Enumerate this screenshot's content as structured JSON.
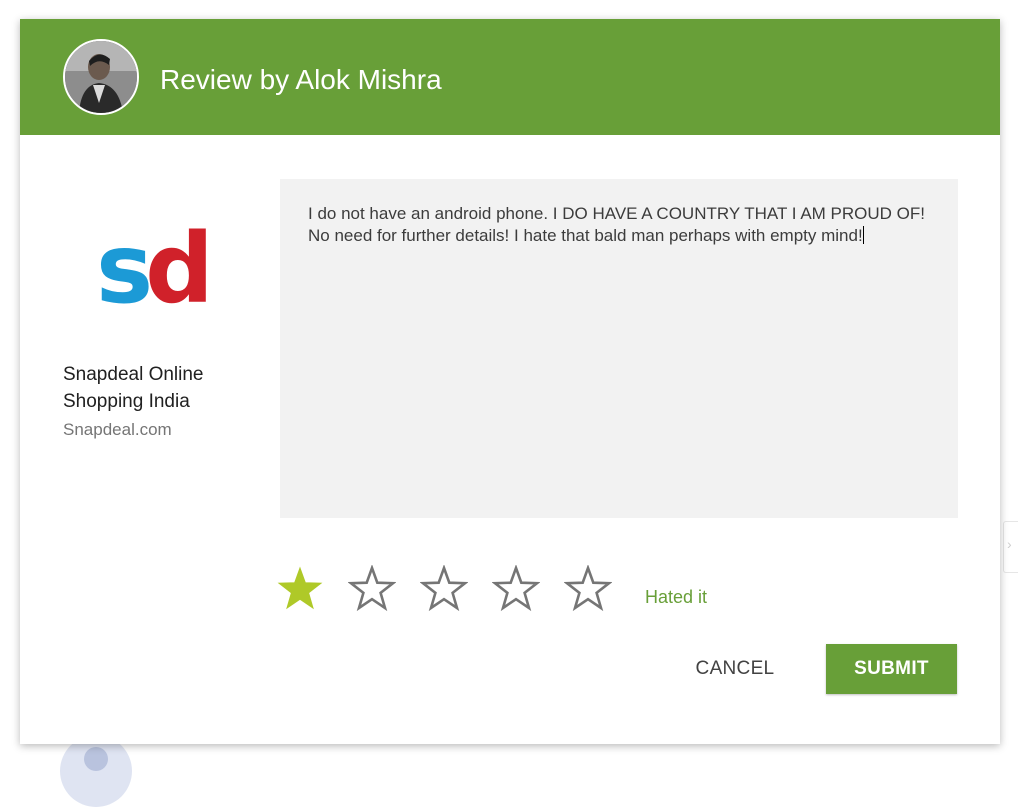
{
  "dialog": {
    "title": "Review by Alok Mishra",
    "header_color": "#689f38"
  },
  "app": {
    "logo_icon": "snapdeal-logo-icon",
    "logo_text": "sd",
    "name": "Snapdeal Online Shopping India",
    "publisher": "Snapdeal.com"
  },
  "review": {
    "text": "I do not have an android phone. I DO HAVE A COUNTRY THAT I AM PROUD OF! No need for further details! I hate that bald man perhaps with empty mind!"
  },
  "rating": {
    "value": 1,
    "max": 5,
    "label": "Hated it",
    "filled_color": "#afc928",
    "empty_color": "#757575"
  },
  "buttons": {
    "cancel": "CANCEL",
    "submit": "SUBMIT"
  }
}
